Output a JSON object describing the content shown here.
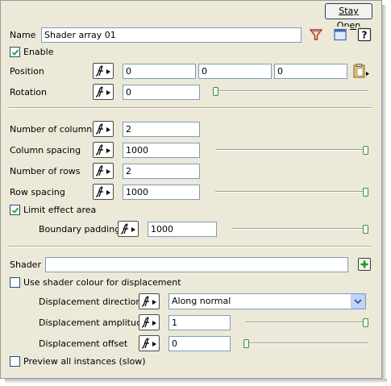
{
  "header": {
    "stay_open_label": "Stay Open"
  },
  "name_row": {
    "label": "Name",
    "value": "Shader array 01"
  },
  "enable": {
    "label": "Enable",
    "checked": true
  },
  "position": {
    "label": "Position",
    "x": "0",
    "y": "0",
    "z": "0"
  },
  "rotation": {
    "label": "Rotation",
    "value": "0"
  },
  "columns": {
    "label": "Number of columns",
    "value": "2"
  },
  "column_spacing": {
    "label": "Column spacing",
    "value": "1000"
  },
  "rows": {
    "label": "Number of rows",
    "value": "2"
  },
  "row_spacing": {
    "label": "Row spacing",
    "value": "1000"
  },
  "limit_effect": {
    "label": "Limit effect area",
    "checked": true
  },
  "boundary_padding": {
    "label": "Boundary padding",
    "value": "1000"
  },
  "shader": {
    "label": "Shader",
    "value": ""
  },
  "use_shader_colour": {
    "label": "Use shader colour for displacement",
    "checked": false
  },
  "displacement_direction": {
    "label": "Displacement direction",
    "value": "Along normal"
  },
  "displacement_amplitude": {
    "label": "Displacement amplitude",
    "value": "1"
  },
  "displacement_offset": {
    "label": "Displacement offset",
    "value": "0"
  },
  "preview_all": {
    "label": "Preview all instances (slow)",
    "checked": false
  },
  "colors": {
    "panel_bg": "#ece9d8",
    "field_border": "#7f9db9",
    "slider_thumb": "#2f9a2f"
  }
}
